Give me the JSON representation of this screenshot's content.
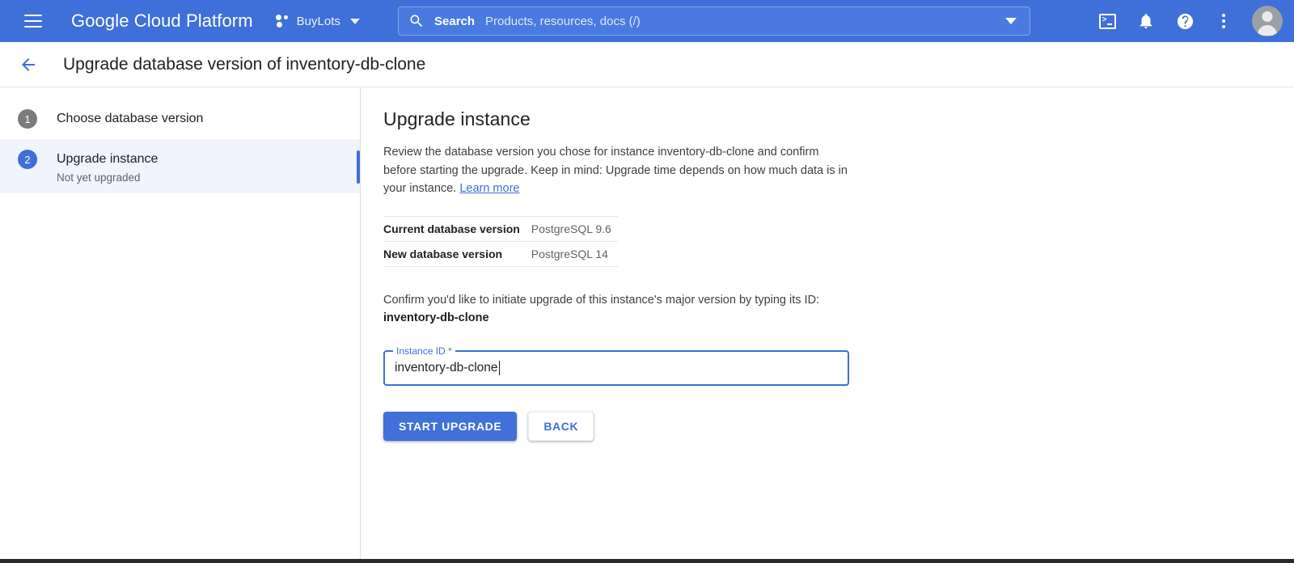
{
  "topbar": {
    "menu_icon": "hamburger-menu-icon",
    "brand": "Google Cloud Platform",
    "project": {
      "icon": "project-dots-icon",
      "name": "BuyLots",
      "caret": "chevron-down-icon"
    },
    "search": {
      "icon": "search-icon",
      "label": "Search",
      "placeholder": "Products, resources, docs (/)",
      "caret": "chevron-down-icon"
    },
    "actions": [
      {
        "icon": "cloud-shell-icon"
      },
      {
        "icon": "notifications-bell-icon"
      },
      {
        "icon": "help-question-icon"
      },
      {
        "icon": "more-options-vertical-dots-icon"
      },
      {
        "icon": "account-avatar-icon"
      }
    ]
  },
  "page": {
    "back_icon": "back-arrow-icon",
    "title": "Upgrade database version of inventory-db-clone"
  },
  "sidebar": {
    "steps": [
      {
        "number": "1",
        "label": "Choose database version",
        "sub": "",
        "active": false
      },
      {
        "number": "2",
        "label": "Upgrade instance",
        "sub": "Not yet upgraded",
        "active": true
      }
    ]
  },
  "main": {
    "title": "Upgrade instance",
    "description_before_link": "Review the database version you chose for instance inventory-db-clone and confirm before starting the upgrade. Keep in mind: Upgrade time depends on how much data is in your instance. ",
    "learn_more": "Learn more",
    "versions": {
      "rows": [
        {
          "key": "Current database version",
          "value": "PostgreSQL 9.6"
        },
        {
          "key": "New database version",
          "value": "PostgreSQL 14"
        }
      ]
    },
    "confirm_text": "Confirm you'd like to initiate upgrade of this instance's major version by typing its ID:",
    "confirm_instance_id": "inventory-db-clone",
    "instance_field": {
      "label": "Instance ID *",
      "value": "inventory-db-clone",
      "placeholder": ""
    },
    "buttons": {
      "primary": "START UPGRADE",
      "secondary": "BACK"
    }
  },
  "colors": {
    "brand_blue": "#3f6fd8",
    "accent_blue": "#4070d8",
    "active_step_bg": "#f1f3fd",
    "inactive_step_gray": "#7b7b7b"
  }
}
